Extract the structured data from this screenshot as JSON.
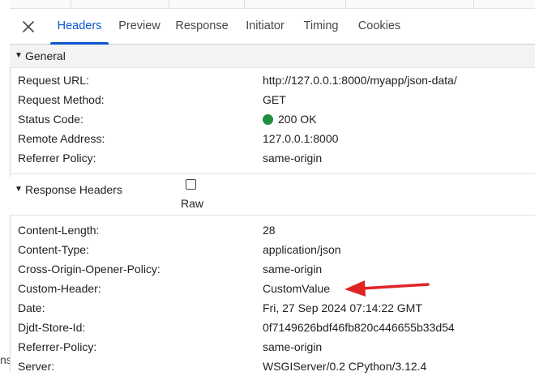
{
  "tabs": [
    {
      "label": "Headers",
      "active": true
    },
    {
      "label": "Preview",
      "active": false
    },
    {
      "label": "Response",
      "active": false
    },
    {
      "label": "Initiator",
      "active": false
    },
    {
      "label": "Timing",
      "active": false
    },
    {
      "label": "Cookies",
      "active": false
    }
  ],
  "left_fragment": "ns",
  "general": {
    "title": "General",
    "rows": [
      {
        "key": "Request URL:",
        "value": "http://127.0.0.1:8000/myapp/json-data/"
      },
      {
        "key": "Request Method:",
        "value": "GET"
      },
      {
        "key": "Status Code:",
        "value": "200 OK"
      },
      {
        "key": "Remote Address:",
        "value": "127.0.0.1:8000"
      },
      {
        "key": "Referrer Policy:",
        "value": "same-origin"
      }
    ]
  },
  "response_headers": {
    "title": "Response Headers",
    "raw_label": "Raw",
    "raw_checked": false,
    "rows": [
      {
        "key": "Content-Length:",
        "value": "28"
      },
      {
        "key": "Content-Type:",
        "value": "application/json"
      },
      {
        "key": "Cross-Origin-Opener-Policy:",
        "value": "same-origin"
      },
      {
        "key": "Custom-Header:",
        "value": "CustomValue"
      },
      {
        "key": "Date:",
        "value": "Fri, 27 Sep 2024 07:14:22 GMT"
      },
      {
        "key": "Djdt-Store-Id:",
        "value": "0f7149626bdf46fb820c446655b33d54"
      },
      {
        "key": "Referrer-Policy:",
        "value": "same-origin"
      },
      {
        "key": "Server:",
        "value": "WSGIServer/0.2 CPython/3.12.4"
      }
    ]
  },
  "colors": {
    "accent": "#0b57d0",
    "status_ok": "#1e8e3e",
    "annotation_arrow": "#e02424"
  },
  "icons": {
    "close": "close-icon",
    "section_toggle": "triangle-down-icon",
    "status": "status-dot-icon",
    "annotation": "red-arrow-annotation"
  }
}
